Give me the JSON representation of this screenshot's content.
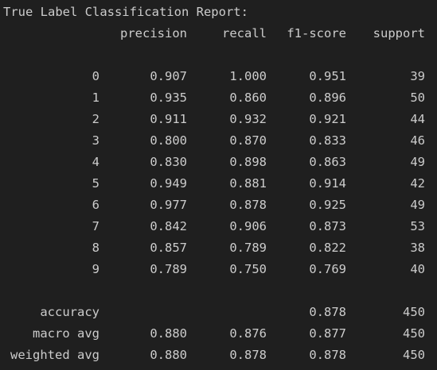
{
  "title": "True Label Classification Report:",
  "headers": [
    "precision",
    "recall",
    "f1-score",
    "support"
  ],
  "class_rows": [
    {
      "label": "0",
      "precision": "0.907",
      "recall": "1.000",
      "f1": "0.951",
      "support": "39"
    },
    {
      "label": "1",
      "precision": "0.935",
      "recall": "0.860",
      "f1": "0.896",
      "support": "50"
    },
    {
      "label": "2",
      "precision": "0.911",
      "recall": "0.932",
      "f1": "0.921",
      "support": "44"
    },
    {
      "label": "3",
      "precision": "0.800",
      "recall": "0.870",
      "f1": "0.833",
      "support": "46"
    },
    {
      "label": "4",
      "precision": "0.830",
      "recall": "0.898",
      "f1": "0.863",
      "support": "49"
    },
    {
      "label": "5",
      "precision": "0.949",
      "recall": "0.881",
      "f1": "0.914",
      "support": "42"
    },
    {
      "label": "6",
      "precision": "0.977",
      "recall": "0.878",
      "f1": "0.925",
      "support": "49"
    },
    {
      "label": "7",
      "precision": "0.842",
      "recall": "0.906",
      "f1": "0.873",
      "support": "53"
    },
    {
      "label": "8",
      "precision": "0.857",
      "recall": "0.789",
      "f1": "0.822",
      "support": "38"
    },
    {
      "label": "9",
      "precision": "0.789",
      "recall": "0.750",
      "f1": "0.769",
      "support": "40"
    }
  ],
  "summary_rows": [
    {
      "label": "accuracy",
      "precision": "",
      "recall": "",
      "f1": "0.878",
      "support": "450"
    },
    {
      "label": "macro avg",
      "precision": "0.880",
      "recall": "0.876",
      "f1": "0.877",
      "support": "450"
    },
    {
      "label": "weighted avg",
      "precision": "0.880",
      "recall": "0.878",
      "f1": "0.878",
      "support": "450"
    }
  ],
  "colors": {
    "background": "#1f1f1f",
    "text": "#cccccc"
  }
}
